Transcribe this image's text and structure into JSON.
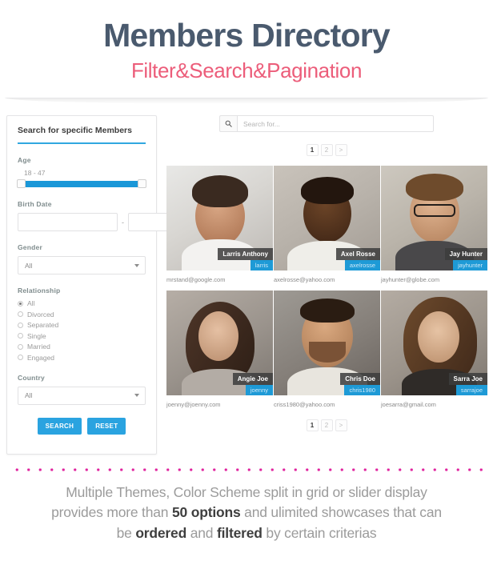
{
  "header": {
    "title": "Members Directory",
    "subtitle": "Filter&Search&Pagination"
  },
  "sidebar": {
    "title": "Search for specific Members",
    "age": {
      "label": "Age",
      "value": "18 - 47"
    },
    "birth_date": {
      "label": "Birth Date",
      "from": "",
      "to": "",
      "separator": "-"
    },
    "gender": {
      "label": "Gender",
      "selected": "All"
    },
    "relationship": {
      "label": "Relationship",
      "options": [
        {
          "label": "All",
          "selected": true
        },
        {
          "label": "Divorced",
          "selected": false
        },
        {
          "label": "Separated",
          "selected": false
        },
        {
          "label": "Single",
          "selected": false
        },
        {
          "label": "Married",
          "selected": false
        },
        {
          "label": "Engaged",
          "selected": false
        }
      ]
    },
    "country": {
      "label": "Country",
      "selected": "All"
    },
    "buttons": {
      "search": "SEARCH",
      "reset": "RESET"
    }
  },
  "search": {
    "placeholder": "Search for...",
    "value": "",
    "icon": "search-icon"
  },
  "pagination_top": {
    "pages": [
      "1",
      "2"
    ],
    "next": ">",
    "active": "1"
  },
  "pagination_bottom": {
    "pages": [
      "1",
      "2"
    ],
    "next": ">",
    "active": "1"
  },
  "members": [
    {
      "name": "Larris Anthony",
      "username": "larris",
      "email": "mrstand@google.com"
    },
    {
      "name": "Axel Rosse",
      "username": "axelrosse",
      "email": "axelrosse@yahoo.com"
    },
    {
      "name": "Jay Hunter",
      "username": "jayhunter",
      "email": "jayhunter@globe.com"
    },
    {
      "name": "Angie Joe",
      "username": "joenny",
      "email": "joenny@joenny.com"
    },
    {
      "name": "Chris Doe",
      "username": "chris1980",
      "email": "criss1980@yahoo.com"
    },
    {
      "name": "Sarra Joe",
      "username": "sarrajoe",
      "email": "joesarra@gmail.com"
    }
  ],
  "footer": {
    "line1": "Multiple Themes, Color Scheme split in grid or slider display",
    "line2_a": "provides more than ",
    "line2_b": "50 options",
    "line2_c": " and ulimited showcases that can",
    "line3_a": "be ",
    "line3_b": "ordered",
    "line3_c": " and ",
    "line3_d": "filtered",
    "line3_e": " by certain criterias"
  },
  "colors": {
    "title": "#4a5a6e",
    "subtitle": "#ec5d7a",
    "accent_blue": "#2aa3e0",
    "dots": "#e0229e"
  }
}
